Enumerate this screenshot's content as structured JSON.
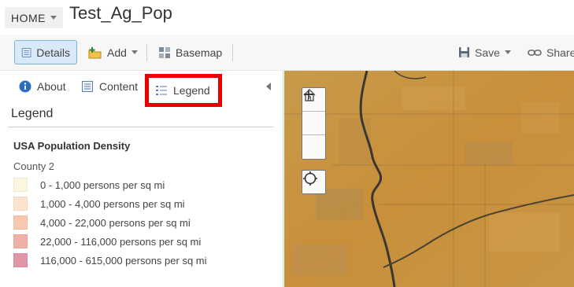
{
  "header": {
    "home_label": "HOME",
    "map_title": "Test_Ag_Pop"
  },
  "toolbar": {
    "details_label": "Details",
    "add_label": "Add",
    "basemap_label": "Basemap",
    "save_label": "Save",
    "share_label": "Share"
  },
  "panel": {
    "tabs": [
      {
        "label": "About",
        "icon": "info-icon"
      },
      {
        "label": "Content",
        "icon": "content-icon"
      },
      {
        "label": "Legend",
        "icon": "legend-list-icon",
        "selected": true
      }
    ],
    "legend": {
      "title": "Legend",
      "layer_name": "USA Population Density",
      "field_name": "County 2",
      "items": [
        {
          "label": "0 - 1,000 persons per sq mi",
          "color": "#fdf6df"
        },
        {
          "label": "1,000 - 4,000 persons per sq mi",
          "color": "#fce3cc"
        },
        {
          "label": "4,000 - 22,000 persons per sq mi",
          "color": "#f7c8ad"
        },
        {
          "label": "22,000 - 116,000 persons per sq mi",
          "color": "#f0b0a7"
        },
        {
          "label": "116,000 - 615,000 persons per sq mi",
          "color": "#e196a7"
        }
      ]
    }
  },
  "colors": {
    "accent": "#7ab3e0",
    "highlight_box": "#e80000",
    "map_base": "#c9933f"
  },
  "map": {
    "controls": [
      "zoom-in",
      "home",
      "zoom-out",
      "locate"
    ]
  }
}
